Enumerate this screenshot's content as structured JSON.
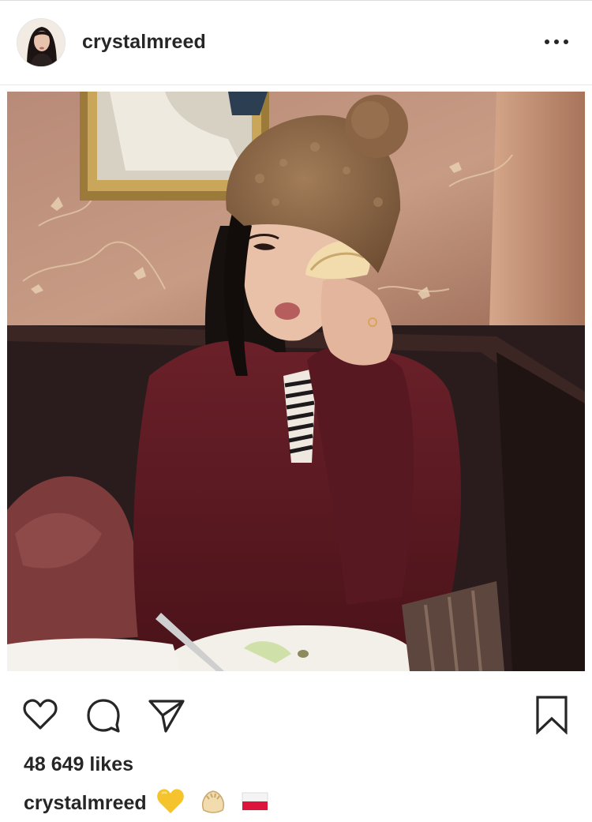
{
  "post": {
    "username": "crystalmreed",
    "likes": "48 649 likes",
    "caption": {
      "username": "crystalmreed",
      "emojis": [
        "yellow-heart",
        "dumpling",
        "poland-flag"
      ]
    }
  },
  "icons": {
    "more": "more-options-icon",
    "like": "heart-icon",
    "comment": "comment-icon",
    "share": "paper-plane-icon",
    "save": "bookmark-icon"
  },
  "colors": {
    "text": "#262626",
    "divider": "#dbdbdb",
    "heart_emoji": "#f5c32c",
    "sweater": "#5e1a24",
    "hat": "#8f6a48"
  }
}
